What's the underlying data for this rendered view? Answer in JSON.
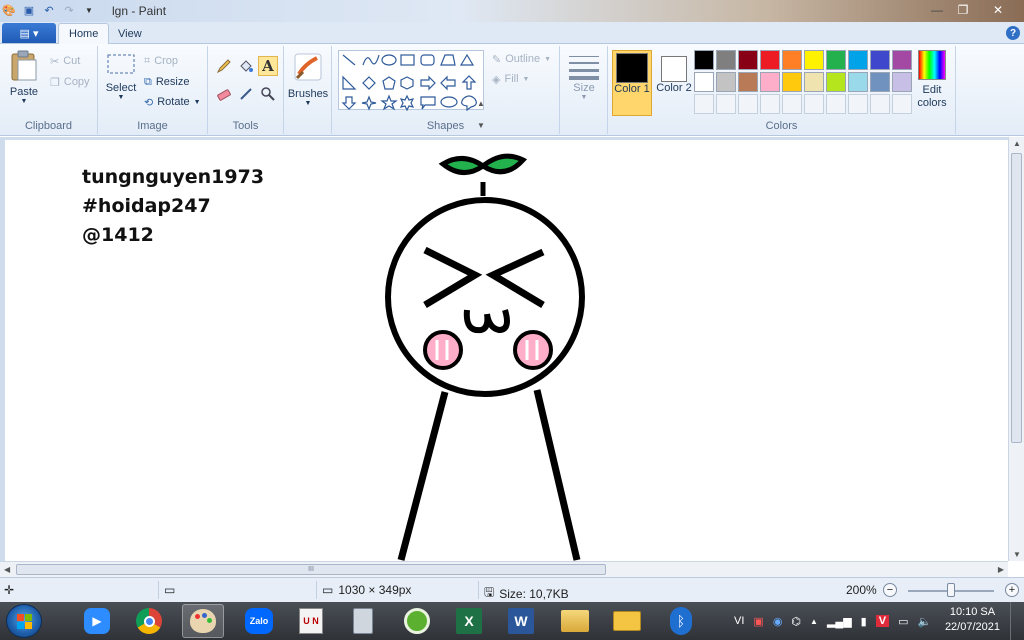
{
  "window": {
    "title": "lgn - Paint",
    "minimize_glyph": "—",
    "maximize_glyph": "❐",
    "close_glyph": "✕"
  },
  "ribbon": {
    "tabs": [
      "Home",
      "View"
    ],
    "help_glyph": "?",
    "clipboard": {
      "paste": "Paste",
      "cut": "Cut",
      "copy": "Copy",
      "label": "Clipboard"
    },
    "image": {
      "select": "Select",
      "crop": "Crop",
      "resize": "Resize",
      "rotate": "Rotate",
      "label": "Image"
    },
    "tools": {
      "label": "Tools",
      "text_tool": "A"
    },
    "brushes": {
      "label": "Brushes"
    },
    "shapes": {
      "outline": "Outline",
      "fill": "Fill",
      "label": "Shapes"
    },
    "size": {
      "label": "Size"
    },
    "colors": {
      "color1": "Color 1",
      "color1_value": "#000000",
      "color2": "Color 2",
      "color2_value": "#ffffff",
      "edit": "Edit colors",
      "label": "Colors",
      "palette_row1": [
        "#000000",
        "#7f7f7f",
        "#880015",
        "#ed1c24",
        "#ff7f27",
        "#fff200",
        "#22b14c",
        "#00a2e8",
        "#3f48cc",
        "#a349a4"
      ],
      "palette_row2": [
        "#ffffff",
        "#c3c3c3",
        "#b97a57",
        "#ffaec9",
        "#ffc90e",
        "#efe4b0",
        "#b5e61d",
        "#99d9ea",
        "#7092be",
        "#c8bfe7"
      ]
    }
  },
  "canvas": {
    "lines": [
      "tungnguyen1973",
      "#hoidap247",
      "@1412"
    ],
    "drawing": {
      "leaf_color": "#22b14c",
      "blush_color": "#ffaec9",
      "ink_color": "#000000",
      "mouth_text": "ω"
    }
  },
  "statusbar": {
    "dimensions": "1030 × 349px",
    "size": "Size: 10,7KB",
    "zoom": "200%",
    "zoom_level": 0.5
  },
  "scrollbars": {
    "grip": "III"
  },
  "taskbar": {
    "apps": [
      "zoom-icon",
      "chrome-icon",
      "paint-icon",
      "zalo-icon",
      "unikey-icon",
      "calculator-icon",
      "coccoc-icon",
      "excel-icon",
      "word-icon",
      "explorer-icon",
      "mail-icon",
      "bluetooth-icon"
    ],
    "zalo_label": "Zalo",
    "unikey_label": "U N",
    "language": "VI",
    "time": "10:10 SA",
    "date": "22/07/2021"
  }
}
